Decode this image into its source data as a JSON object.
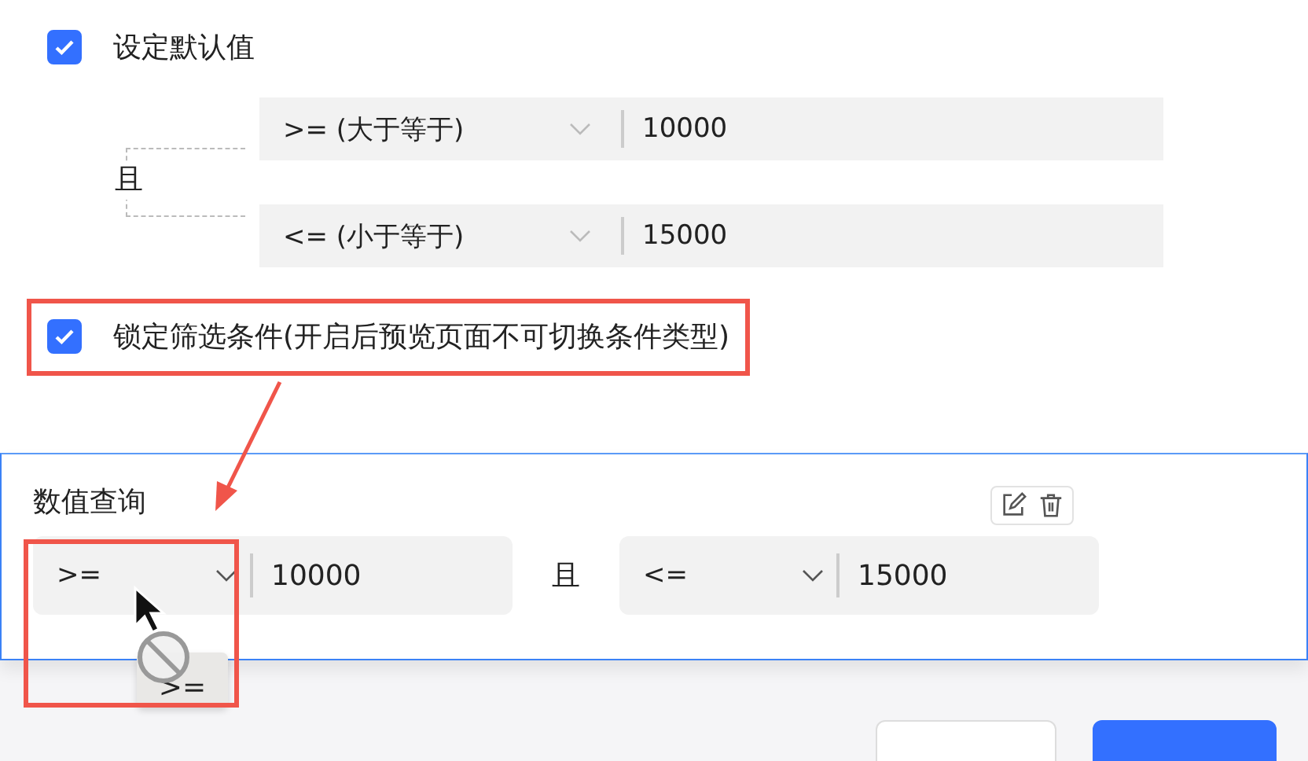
{
  "default_value": {
    "label": "设定默认值",
    "checked": true
  },
  "conditions": {
    "joiner": "且",
    "rows": [
      {
        "operator": ">= (大于等于)",
        "value": "10000"
      },
      {
        "operator": "<= (小于等于)",
        "value": "15000"
      }
    ]
  },
  "lock": {
    "label": "锁定筛选条件(开启后预览页面不可切换条件类型)",
    "checked": true
  },
  "query_panel": {
    "title": "数值查询",
    "joiner": "且",
    "fields": [
      {
        "operator": ">=",
        "value": "10000"
      },
      {
        "operator": "<=",
        "value": "15000"
      }
    ]
  },
  "drag_tooltip": ">="
}
